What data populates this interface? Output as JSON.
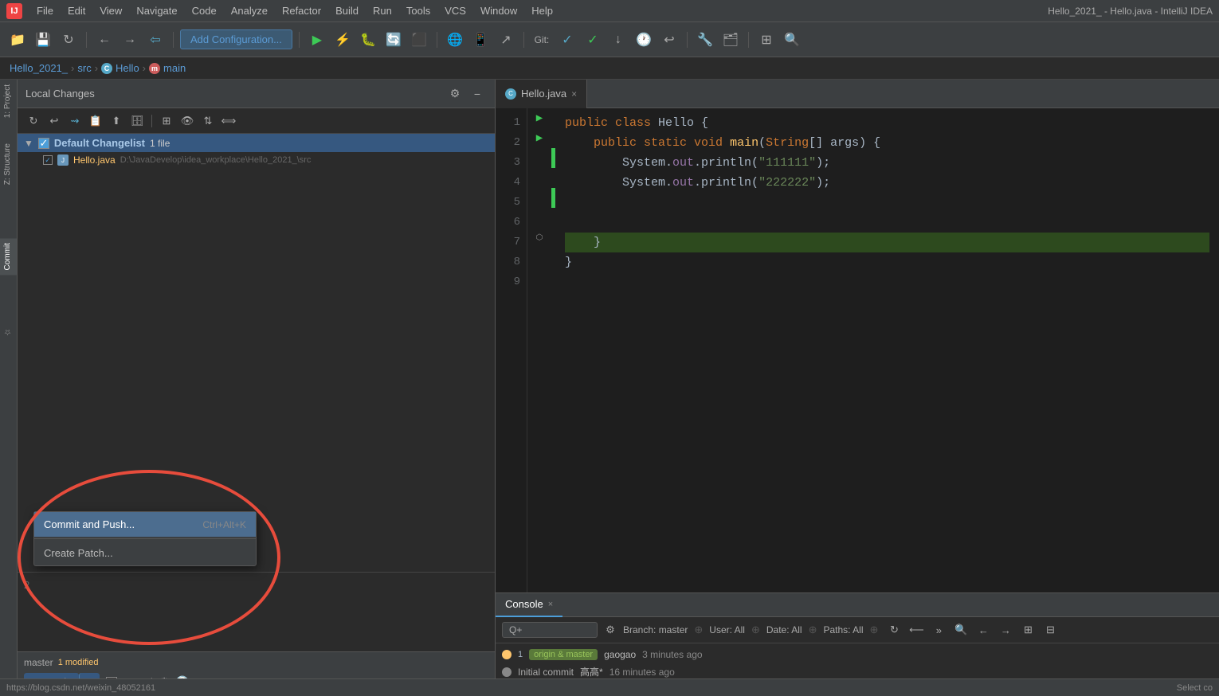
{
  "window": {
    "title": "Hello_2021_ - Hello.java - IntelliJ IDEA"
  },
  "menubar": {
    "logo": "IJ",
    "items": [
      "File",
      "Edit",
      "View",
      "Navigate",
      "Code",
      "Analyze",
      "Refactor",
      "Build",
      "Run",
      "Tools",
      "VCS",
      "Window",
      "Help"
    ]
  },
  "toolbar": {
    "config_btn": "Add Configuration...",
    "git_label": "Git:"
  },
  "breadcrumb": {
    "project": "Hello_2021_",
    "src": "src",
    "hello": "Hello",
    "main": "main"
  },
  "local_changes": {
    "title": "Local Changes",
    "changelist_name": "Default Changelist",
    "changelist_count": "1 file",
    "file_name": "Hello.java",
    "file_path": "D:\\JavaDevelop\\idea_workplace\\Hello_2021_\\src"
  },
  "commit": {
    "label": "Commit",
    "dropdown_arrow": "▼",
    "amend_label": "Amend",
    "branch": "master",
    "modified": "1 modified",
    "message_num": "2"
  },
  "dropdown": {
    "items": [
      {
        "label": "Commit and Push...",
        "shortcut": "Ctrl+Alt+K",
        "active": true
      },
      {
        "label": "Create Patch...",
        "shortcut": "",
        "active": false
      }
    ]
  },
  "editor": {
    "tab_name": "Hello.java",
    "lines": [
      {
        "num": 1,
        "content": "public class Hello {",
        "run": true,
        "modified": false
      },
      {
        "num": 2,
        "content": "    public static void main(String[] args) {",
        "run": true,
        "modified": false
      },
      {
        "num": 3,
        "content": "        System.out.println(\"111111\");",
        "run": false,
        "modified": true
      },
      {
        "num": 4,
        "content": "        System.out.println(\"222222\");",
        "run": false,
        "modified": false
      },
      {
        "num": 5,
        "content": "",
        "run": false,
        "modified": true
      },
      {
        "num": 6,
        "content": "",
        "run": false,
        "modified": false
      },
      {
        "num": 7,
        "content": "    }",
        "run": false,
        "modified": false,
        "highlighted": true
      },
      {
        "num": 8,
        "content": "}",
        "run": false,
        "modified": false
      },
      {
        "num": 9,
        "content": "",
        "run": false,
        "modified": false
      }
    ]
  },
  "bottom_panel": {
    "tabs": [
      "Console",
      "×"
    ],
    "search_placeholder": "Q+",
    "filters": {
      "branch": "Branch: master",
      "user": "User: All",
      "date": "Date: All",
      "paths": "Paths: All"
    },
    "commits": [
      {
        "dot": "yellow",
        "tag": "origin & master",
        "author": "gaogao",
        "time": "3 minutes ago",
        "message": "Initial commit"
      },
      {
        "dot": "gray",
        "tag": "",
        "author": "高高*",
        "time": "16 minutes ago",
        "message": ""
      }
    ]
  },
  "status_bar": {
    "url": "https://blog.csdn.net/weixin_48052161",
    "select": "Select co"
  },
  "icons": {
    "refresh": "↻",
    "undo": "↩",
    "plus": "+",
    "settings": "⚙",
    "minus": "−",
    "eye": "👁",
    "sort": "⇅",
    "group": "⊞",
    "check": "✓",
    "arrow_down": "▼",
    "close": "×",
    "run_arrow": "▶",
    "search": "🔍"
  }
}
